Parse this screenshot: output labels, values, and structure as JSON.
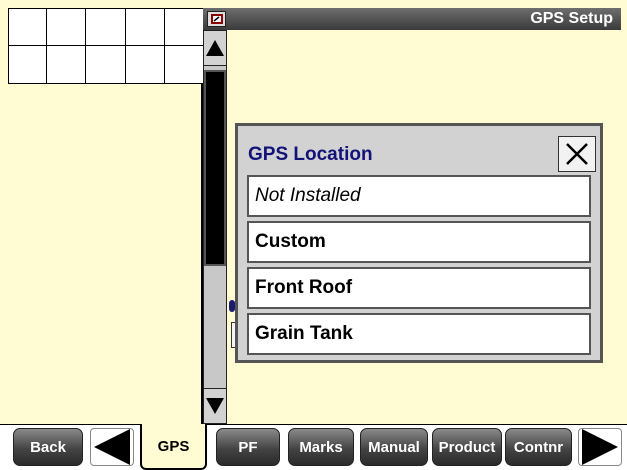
{
  "header": {
    "title": "GPS Setup",
    "icon": "wrench-screen-icon"
  },
  "dialog": {
    "title": "GPS Location",
    "options": [
      {
        "label": "Not Installed"
      },
      {
        "label": "Custom"
      },
      {
        "label": "Front Roof"
      },
      {
        "label": "Grain Tank"
      }
    ]
  },
  "bottom_tabs": {
    "back": "Back",
    "gps": "GPS",
    "pf": "PF",
    "marks": "Marks",
    "manual": "Manual",
    "product": "Product",
    "contnr": "Contnr"
  },
  "colors": {
    "background": "#fffbd2",
    "dialog_title": "#12127a",
    "tab_dark": "#3a3a3a"
  }
}
